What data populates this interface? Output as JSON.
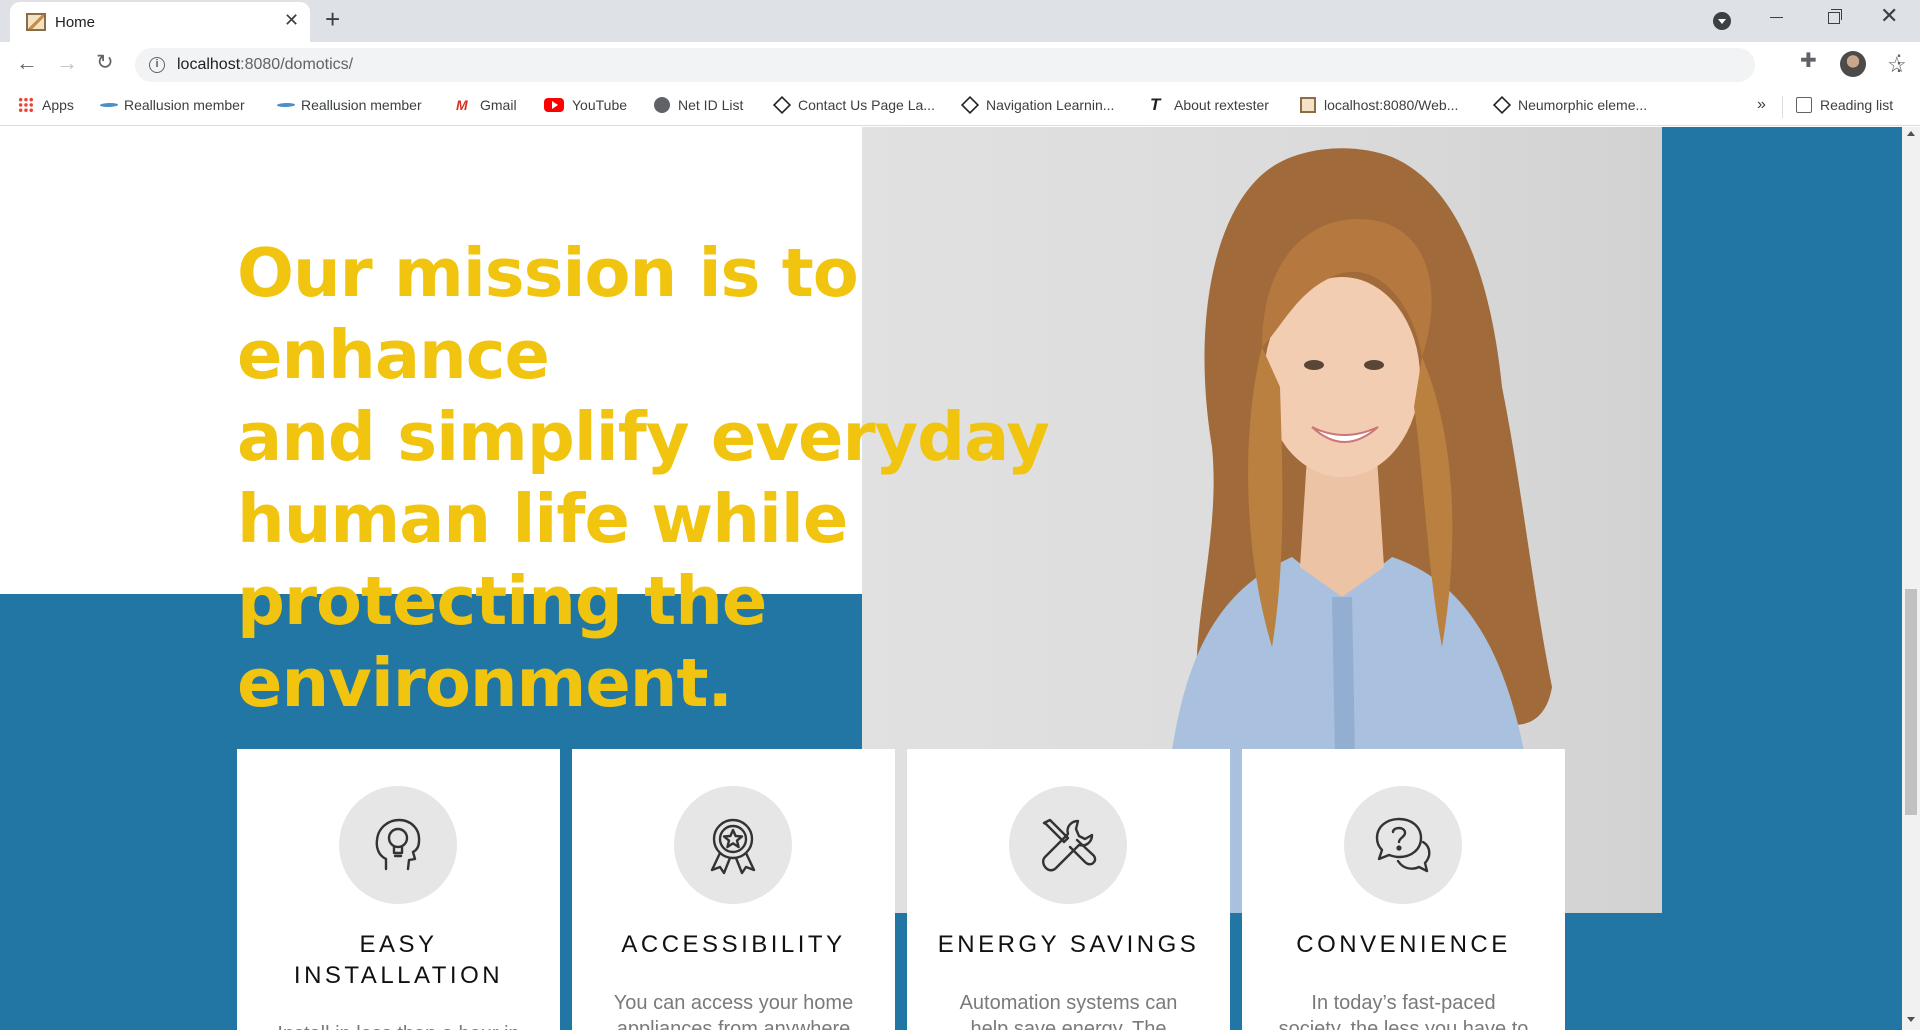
{
  "browser": {
    "tab_title": "Home",
    "tab_close": "✕",
    "new_tab": "+",
    "url_host": "localhost",
    "url_rest": ":8080/domotics/",
    "window_close": "✕"
  },
  "bookmarks": [
    {
      "label": "Apps",
      "icon": "apps-icon"
    },
    {
      "label": "Reallusion member",
      "icon": "reallusion-icon"
    },
    {
      "label": "Reallusion member",
      "icon": "reallusion-icon"
    },
    {
      "label": "Gmail",
      "icon": "gmail-icon"
    },
    {
      "label": "YouTube",
      "icon": "youtube-icon"
    },
    {
      "label": "Net ID List",
      "icon": "globe-icon"
    },
    {
      "label": "Contact Us Page La...",
      "icon": "codepen-icon"
    },
    {
      "label": "Navigation Learnin...",
      "icon": "codepen-icon"
    },
    {
      "label": "About rextester",
      "icon": "t-icon"
    },
    {
      "label": "localhost:8080/Web...",
      "icon": "site-icon"
    },
    {
      "label": "Neumorphic eleme...",
      "icon": "codepen-icon"
    }
  ],
  "bookmarks_more": "»",
  "reading_list": "Reading list",
  "hero": {
    "mission_lines": [
      "Our mission is to enhance",
      "and simplify everyday",
      "human life while",
      "protecting the",
      "environment."
    ]
  },
  "cards": [
    {
      "title_lines": [
        "EASY",
        "INSTALLATION"
      ],
      "text": "Install in less than a hour in",
      "icon": "lightbulb-head-icon"
    },
    {
      "title_lines": [
        "ACCESSIBILITY"
      ],
      "text_lines": [
        "You can access your home",
        "appliances from anywhere"
      ],
      "icon": "award-badge-icon"
    },
    {
      "title_lines": [
        "ENERGY SAVINGS"
      ],
      "text_lines": [
        "Automation systems can",
        "help save energy. The"
      ],
      "icon": "tools-icon"
    },
    {
      "title_lines": [
        "CONVENIENCE"
      ],
      "text_lines": [
        "In today’s fast-paced",
        "society, the less you have to"
      ],
      "icon": "question-chat-icon"
    }
  ],
  "colors": {
    "accent_yellow": "#f1c40f",
    "brand_blue": "#2176a3"
  }
}
